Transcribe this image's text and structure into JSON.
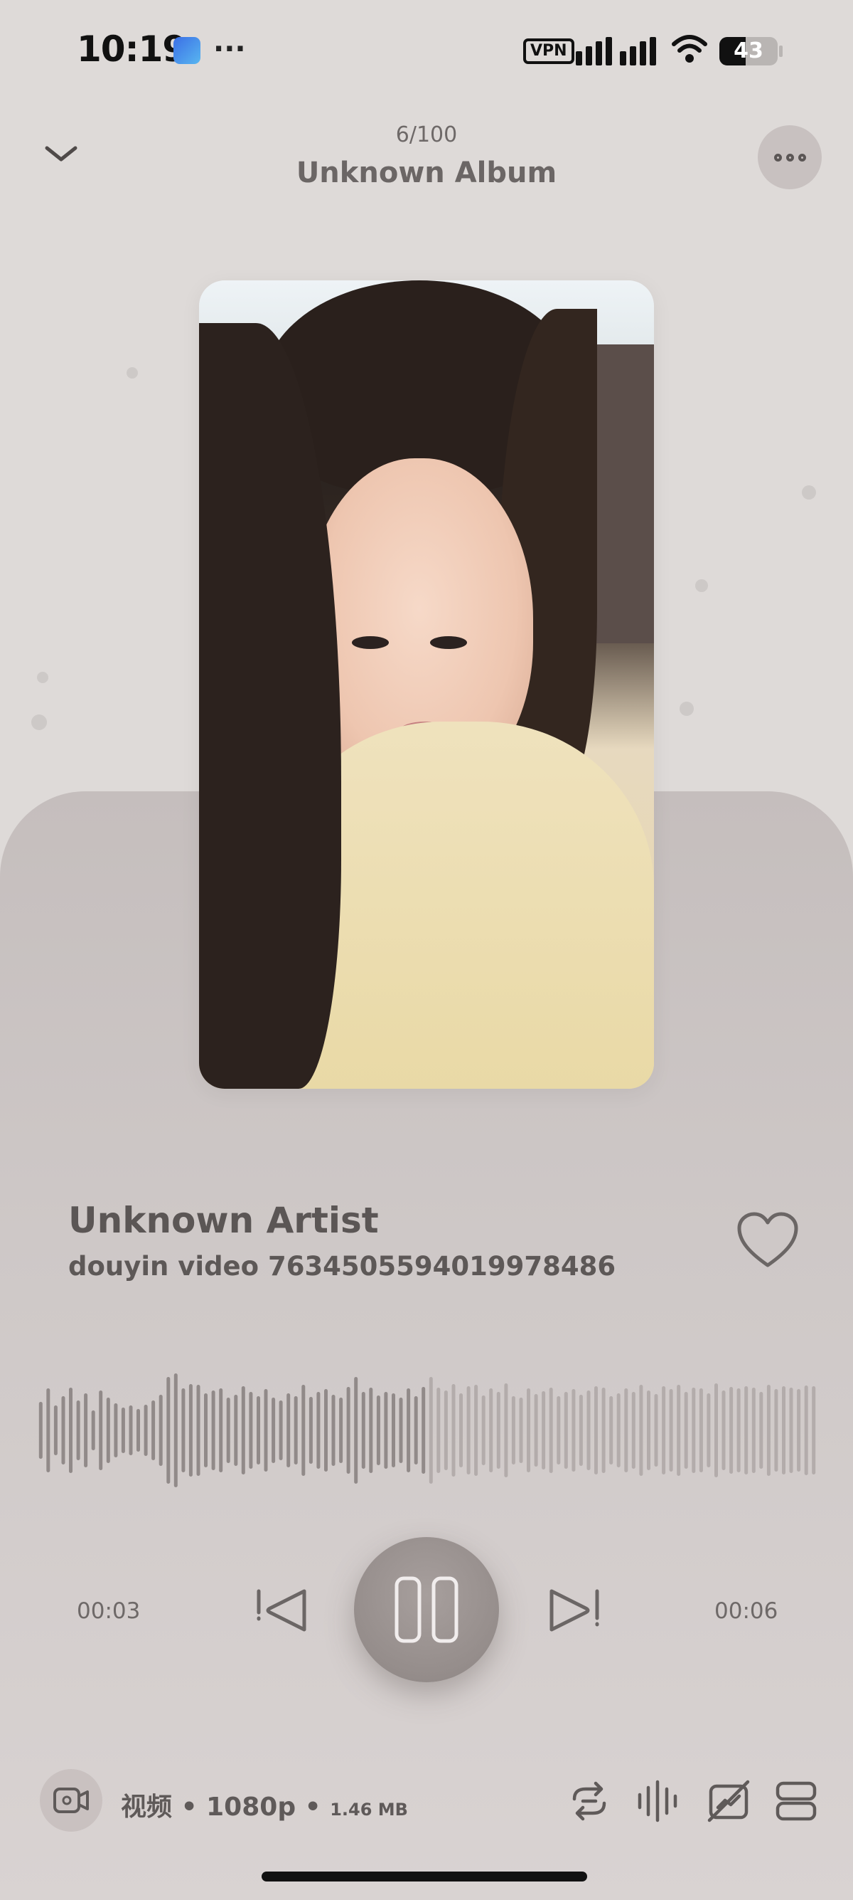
{
  "status_bar": {
    "time": "10:19",
    "extra": "···",
    "vpn": "VPN",
    "battery": "43"
  },
  "header": {
    "counter": "6/100",
    "album": "Unknown Album"
  },
  "song": {
    "artist": "Unknown Artist",
    "title": "douyin video 7634505594019978486",
    "liked": false
  },
  "progress": {
    "current": "00:03",
    "total": "00:06",
    "played_fraction": 0.5,
    "state": "playing"
  },
  "footer": {
    "format": "视频",
    "separator": "•",
    "quality": "1080p",
    "size": "1.46 MB"
  },
  "icons": {
    "collapse": "chevron-down-icon",
    "more": "more-dots-icon",
    "like": "heart-icon",
    "previous": "previous-icon",
    "pause": "pause-icon",
    "next": "next-icon",
    "video": "video-icon",
    "repeat": "repeat-icon",
    "equalizer": "equalizer-icon",
    "lyrics": "lyrics-off-icon",
    "queue": "queue-icon"
  },
  "colors": {
    "background": "#dedad8",
    "panel": "#cec8c7",
    "text": "#5d5857",
    "played_wave": "#918a89",
    "unplayed_wave": "#b3acab"
  }
}
